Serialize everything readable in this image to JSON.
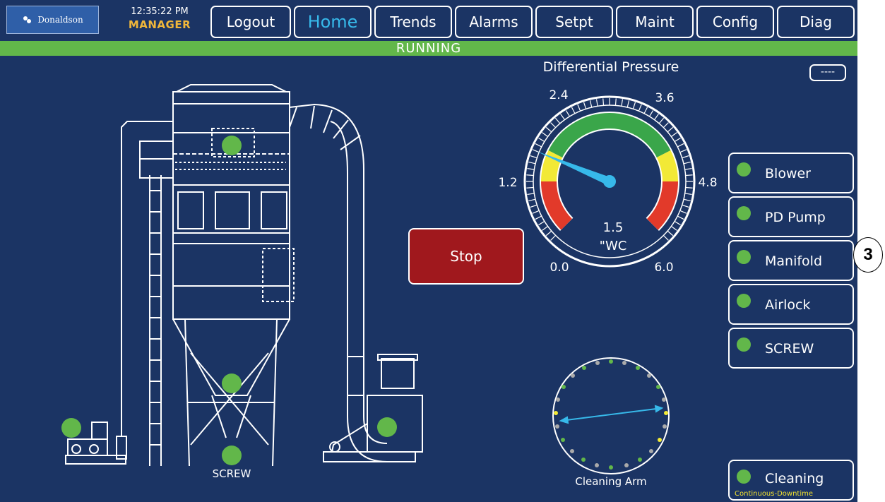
{
  "header": {
    "logo_text": "Donaldson",
    "time": "12:35:22 PM",
    "role": "MANAGER"
  },
  "nav": {
    "logout": "Logout",
    "home": "Home",
    "trends": "Trends",
    "alarms": "Alarms",
    "setpt": "Setpt",
    "maint": "Maint",
    "config": "Config",
    "diag": "Diag"
  },
  "status": {
    "text": "RUNNING"
  },
  "gauge": {
    "title": "Differential Pressure",
    "units_button": "----",
    "value": "1.5",
    "unit": "\"WC",
    "value_num": 1.5,
    "min": 0.0,
    "max": 6.0,
    "ticks": {
      "t0": "0.0",
      "t12": "1.2",
      "t24": "2.4",
      "t36": "3.6",
      "t48": "4.8",
      "t60": "6.0"
    },
    "zones": {
      "red": "#e23a2a",
      "yellow": "#f2e936",
      "green": "#3aa64a"
    }
  },
  "controls": {
    "stop": "Stop"
  },
  "side_panel": {
    "blower": "Blower",
    "pd_pump": "PD Pump",
    "manifold": "Manifold",
    "airlock": "Airlock",
    "screw": "SCREW",
    "cleaning": "Cleaning",
    "cleaning_mode": "Continuous-Downtime"
  },
  "diagram": {
    "screw_label": "SCREW",
    "cleaning_arm_label": "Cleaning Arm"
  },
  "callout": {
    "number": "3"
  },
  "colors": {
    "background": "#1b3464",
    "running": "#62b74a",
    "accent": "#37b9ea",
    "stop": "#a0181d",
    "role": "#f0b63a"
  }
}
